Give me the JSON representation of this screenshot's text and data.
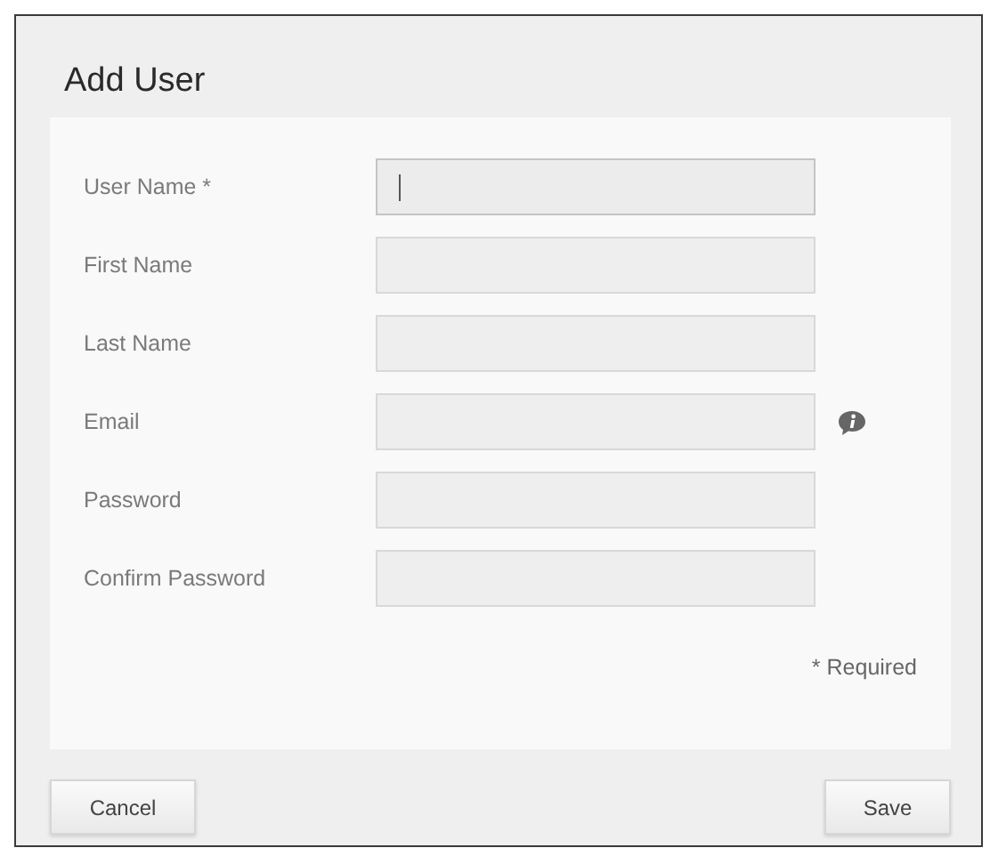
{
  "dialog": {
    "title": "Add User"
  },
  "fields": [
    {
      "label": "User Name *",
      "focused": true,
      "info": false
    },
    {
      "label": "First Name",
      "focused": false,
      "info": false
    },
    {
      "label": "Last Name",
      "focused": false,
      "info": false
    },
    {
      "label": "Email",
      "focused": false,
      "info": true
    },
    {
      "label": "Password",
      "focused": false,
      "info": false
    },
    {
      "label": "Confirm Password",
      "focused": false,
      "info": false
    }
  ],
  "required_note": "* Required",
  "buttons": {
    "cancel": "Cancel",
    "save": "Save"
  }
}
